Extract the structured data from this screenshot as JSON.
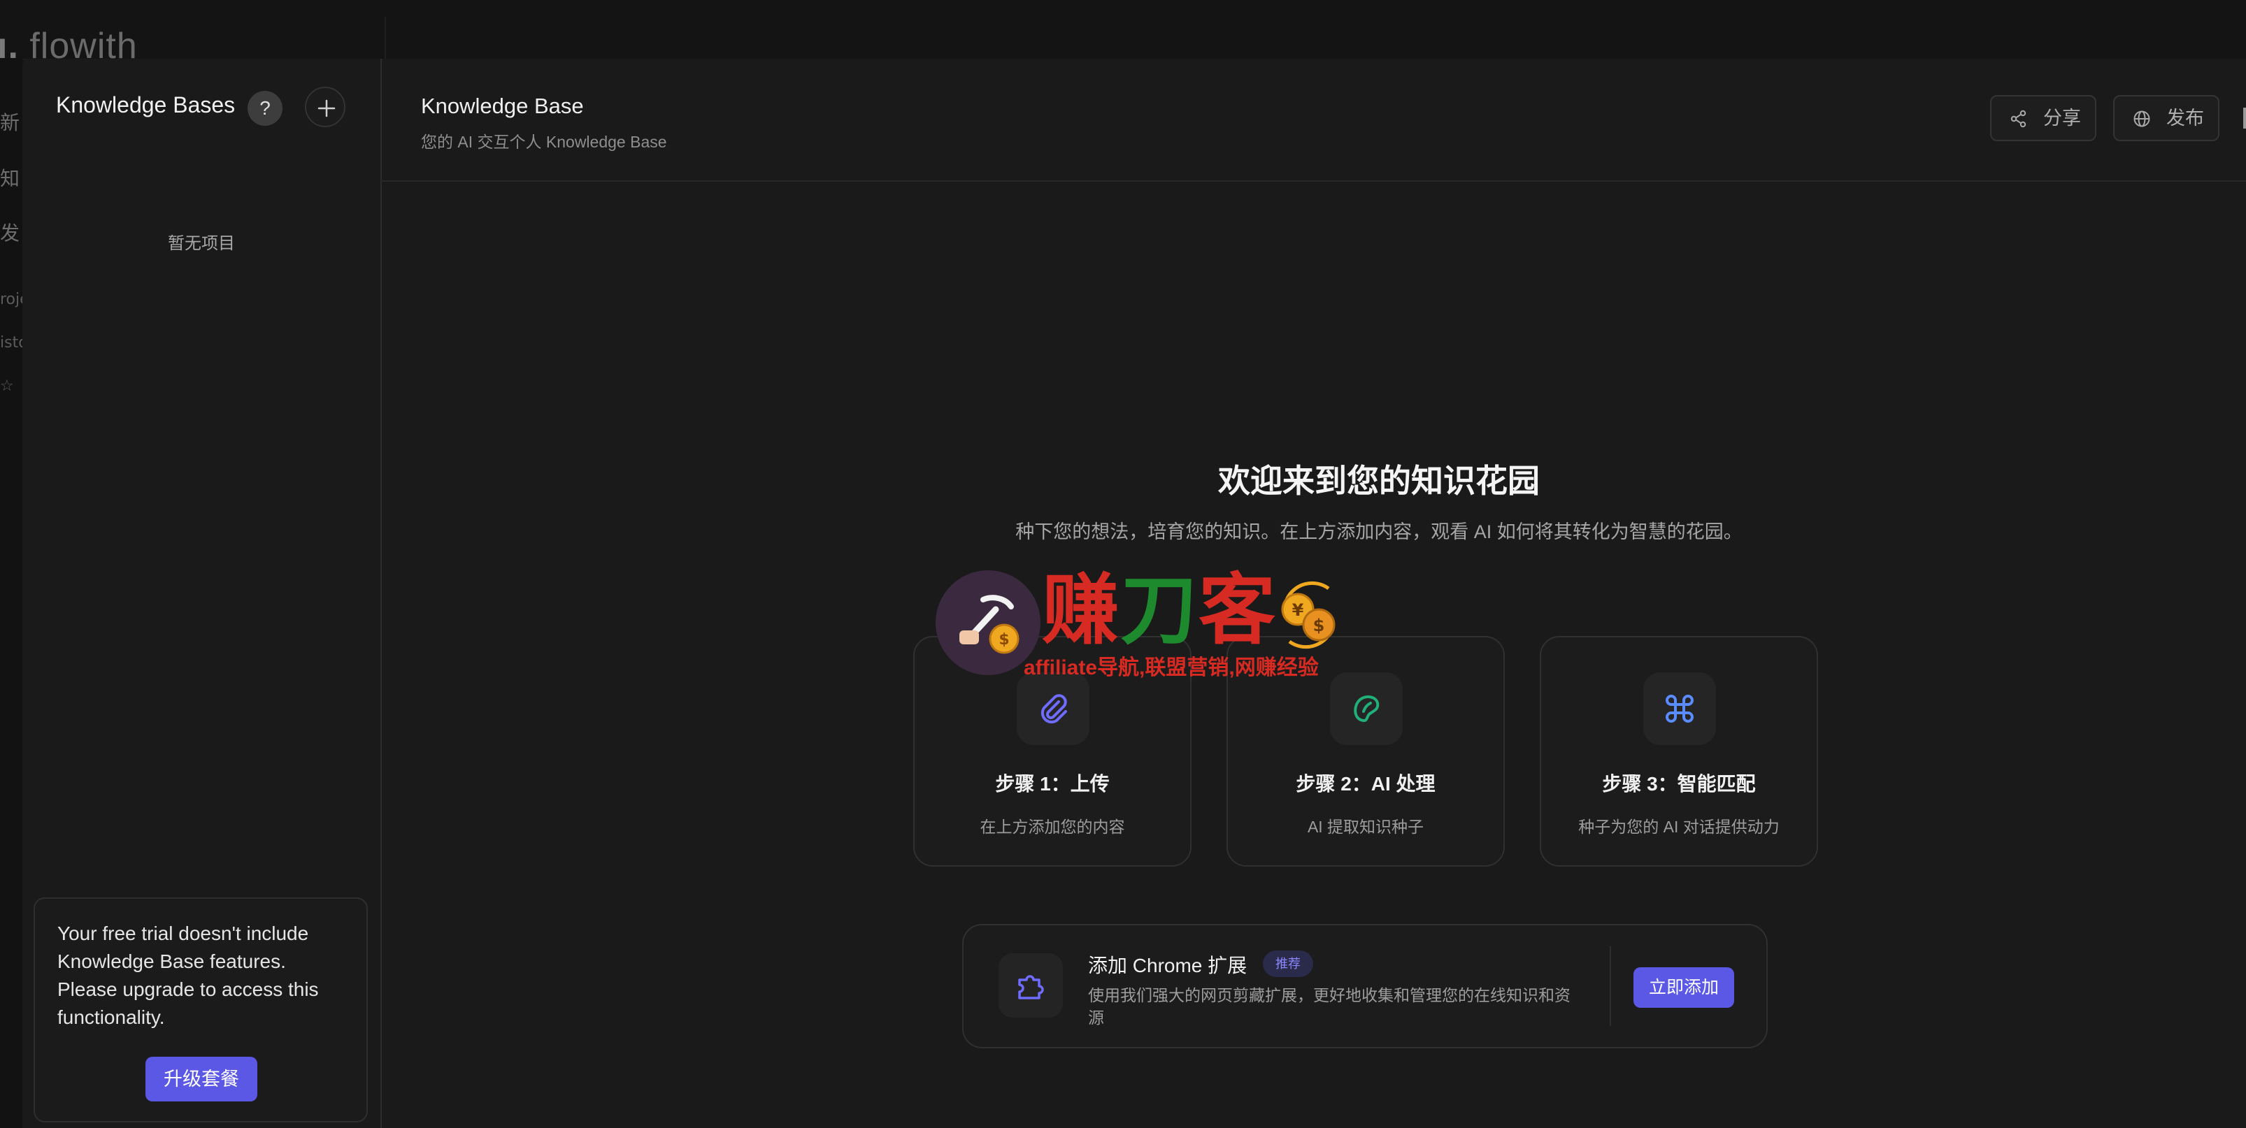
{
  "app": {
    "logo_text": "flowith"
  },
  "background_nav": {
    "items": [
      "新",
      "知",
      "发"
    ],
    "small_items": [
      "roje",
      "isto",
      "☆"
    ]
  },
  "sidebar": {
    "title": "Knowledge Bases",
    "help_label": "?",
    "empty_text": "暂无项目",
    "trial_notice": "Your free trial doesn't include Knowledge Base features. Please upgrade to access this functionality.",
    "upgrade_label": "升级套餐"
  },
  "header": {
    "title": "Knowledge Base",
    "subtitle": "您的 AI 交互个人 Knowledge Base",
    "share_label": "分享",
    "publish_label": "发布"
  },
  "main": {
    "welcome_title": "欢迎来到您的知识花园",
    "welcome_desc": "种下您的想法，培育您的知识。在上方添加内容，观看 AI 如何将其转化为智慧的花园。",
    "steps": [
      {
        "title": "步骤 1：上传",
        "desc": "在上方添加您的内容",
        "icon": "paperclip-icon"
      },
      {
        "title": "步骤 2：AI 处理",
        "desc": "AI 提取知识种子",
        "icon": "seed-icon"
      },
      {
        "title": "步骤 3：智能匹配",
        "desc": "种子为您的 AI 对话提供动力",
        "icon": "command-icon"
      }
    ],
    "chrome_ext": {
      "title": "添加 Chrome 扩展",
      "badge": "推荐",
      "desc": "使用我们强大的网页剪藏扩展，更好地收集和管理您的在线知识和资源",
      "button": "立即添加"
    }
  },
  "watermark": {
    "part1": "赚",
    "part2": "刀",
    "part3": "客",
    "tagline": "affiliate导航,联盟营销,网赚经验"
  },
  "colors": {
    "accent": "#5b58e6",
    "background": "#1a1a1a",
    "step_icon_1": "#6f6cff",
    "step_icon_2": "#22b07a",
    "step_icon_3": "#5b8cff"
  }
}
